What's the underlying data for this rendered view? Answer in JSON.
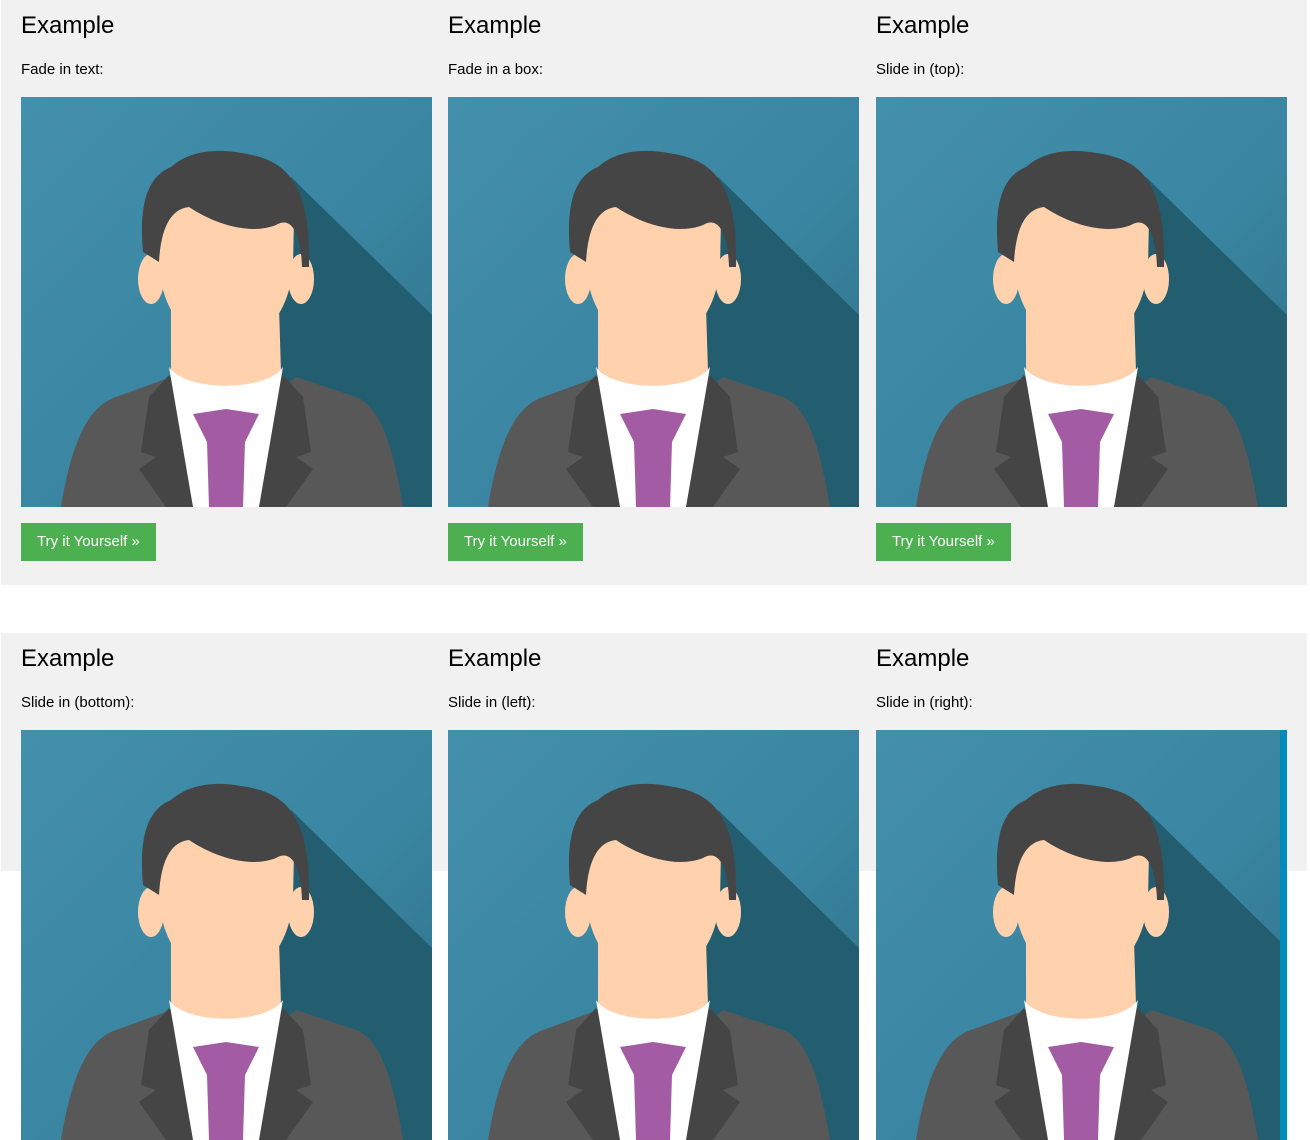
{
  "colors": {
    "section_bg": "#f1f1f1",
    "button_bg": "#4caf50",
    "button_text": "#ffffff",
    "overlay_accent": "#008cba",
    "avatar_bg": "#3f8ba8",
    "avatar_hair": "#454545",
    "avatar_skin": "#ffd2ad",
    "avatar_suit": "#585858",
    "avatar_tie": "#a35ca3"
  },
  "sections": [
    {
      "examples": [
        {
          "heading": "Example",
          "description": "Fade in text:",
          "image": "businessman-avatar-image",
          "button_label": "Try it Yourself »"
        },
        {
          "heading": "Example",
          "description": "Fade in a box:",
          "image": "businessman-avatar-image",
          "button_label": "Try it Yourself »"
        },
        {
          "heading": "Example",
          "description": "Slide in (top):",
          "image": "businessman-avatar-image",
          "button_label": "Try it Yourself »"
        }
      ]
    },
    {
      "examples": [
        {
          "heading": "Example",
          "description": "Slide in (bottom):",
          "image": "businessman-avatar-image"
        },
        {
          "heading": "Example",
          "description": "Slide in (left):",
          "image": "businessman-avatar-image"
        },
        {
          "heading": "Example",
          "description": "Slide in (right):",
          "image": "businessman-avatar-image"
        }
      ]
    }
  ]
}
